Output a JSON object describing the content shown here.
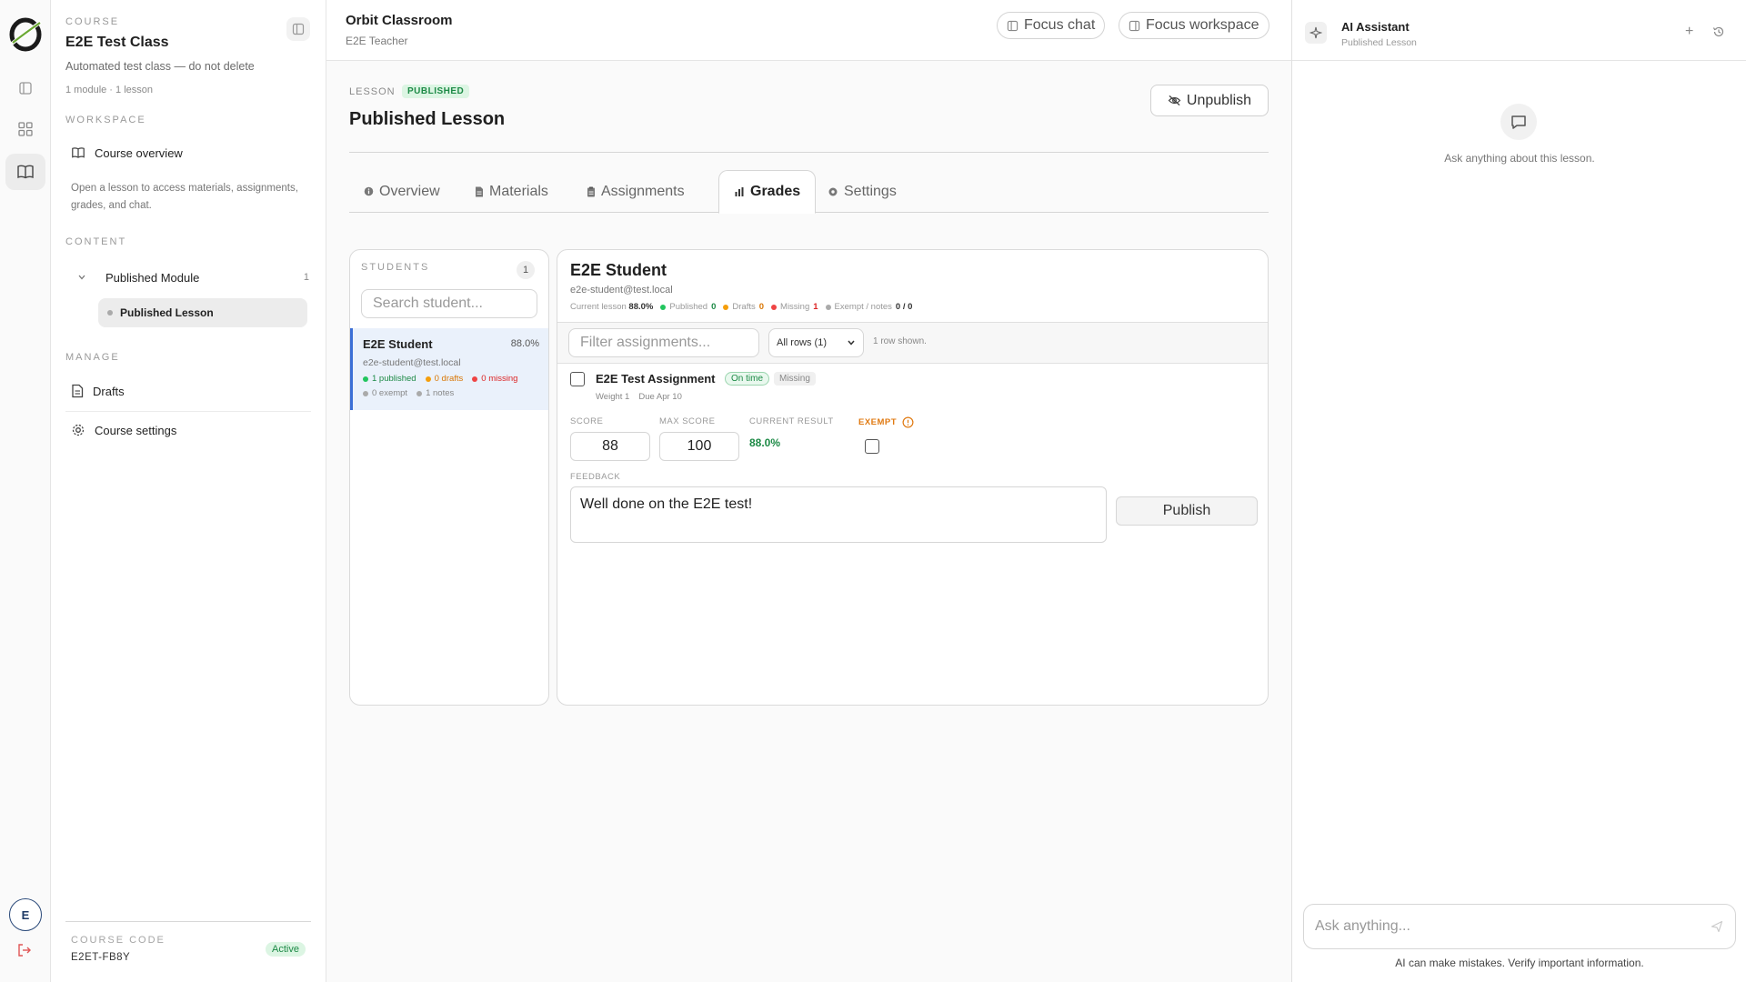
{
  "rail": {
    "avatar_letter": "E"
  },
  "sidebar": {
    "course_eyebrow": "COURSE",
    "course_title": "E2E Test Class",
    "course_description": "Automated test class — do not delete",
    "course_meta": "1 module · 1 lesson",
    "workspace_eyebrow": "WORKSPACE",
    "course_overview_label": "Course overview",
    "workspace_note": "Open a lesson to access materials, assignments, grades, and chat.",
    "content_eyebrow": "CONTENT",
    "module_label": "Published Module",
    "module_count": "1",
    "lesson_label": "Published Lesson",
    "manage_eyebrow": "MANAGE",
    "drafts_label": "Drafts",
    "settings_label": "Course settings",
    "course_code_eyebrow": "COURSE CODE",
    "course_code": "E2ET-FB8Y",
    "status_badge": "Active"
  },
  "topbar": {
    "app_title": "Orbit Classroom",
    "app_subtitle": "E2E Teacher",
    "focus_chat_label": "Focus chat",
    "focus_workspace_label": "Focus workspace"
  },
  "lesson": {
    "eyebrow": "LESSON",
    "status_badge": "PUBLISHED",
    "title": "Published Lesson",
    "unpublish_label": "Unpublish"
  },
  "tabs": [
    {
      "label": "Overview",
      "icon": "info-icon"
    },
    {
      "label": "Materials",
      "icon": "document-icon"
    },
    {
      "label": "Assignments",
      "icon": "clipboard-icon"
    },
    {
      "label": "Grades",
      "icon": "bar-chart-icon"
    },
    {
      "label": "Settings",
      "icon": "gear-icon"
    }
  ],
  "students": {
    "eyebrow": "STUDENTS",
    "count": "1",
    "search_placeholder": "Search student...",
    "list": [
      {
        "name": "E2E Student",
        "percent": "88.0%",
        "email": "e2e-student@test.local",
        "published": "1 published",
        "drafts": "0 drafts",
        "missing": "0 missing",
        "exempt": "0 exempt",
        "notes": "1 notes"
      }
    ]
  },
  "detail": {
    "student_name": "E2E Student",
    "student_email": "e2e-student@test.local",
    "summary": {
      "current_lesson_label": "Current lesson",
      "current_lesson_value": "88.0%",
      "published_label": "Published",
      "published_value": "0",
      "drafts_label": "Drafts",
      "drafts_value": "0",
      "missing_label": "Missing",
      "missing_value": "1",
      "exempt_label": "Exempt / notes",
      "exempt_value": "0 / 0"
    },
    "filter_placeholder": "Filter assignments...",
    "rows_select": "All rows (1)",
    "rows_shown": "1 row shown.",
    "assignment": {
      "title": "E2E Test Assignment",
      "ontime_badge": "On time",
      "missing_badge": "Missing",
      "weight": "Weight 1",
      "due": "Due Apr 10",
      "score_label": "SCORE",
      "score_value": "88",
      "max_label": "MAX SCORE",
      "max_value": "100",
      "result_label": "CURRENT RESULT",
      "result_value": "88.0%",
      "exempt_label": "EXEMPT",
      "feedback_label": "FEEDBACK",
      "feedback_value": "Well done on the E2E test!",
      "publish_label": "Publish"
    }
  },
  "ai": {
    "title": "AI Assistant",
    "subtitle": "Published Lesson",
    "empty_text": "Ask anything about this lesson.",
    "input_placeholder": "Ask anything...",
    "disclaimer": "AI can make mistakes. Verify important information."
  },
  "colors": {
    "accent_blue": "#3b6fd6",
    "success_green": "#1d8a46",
    "warning_orange": "#f59e0b",
    "danger_red": "#dc2626",
    "exempt_orange": "#e07a12"
  }
}
